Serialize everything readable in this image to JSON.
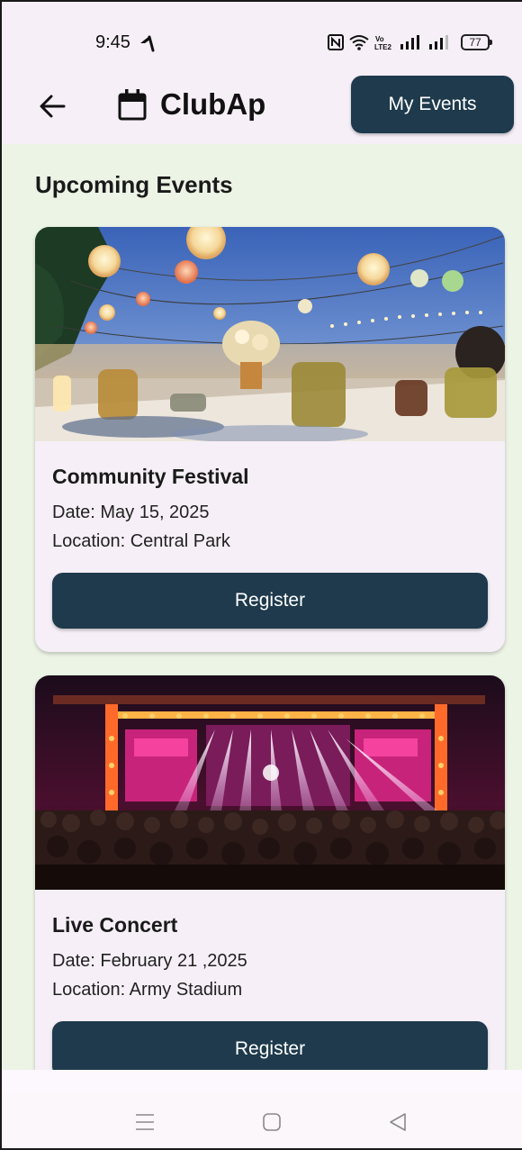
{
  "status_bar": {
    "time": "9:45",
    "battery": "77",
    "icons": [
      "carrier-icon",
      "nfc-icon",
      "wifi-icon",
      "volte-icon",
      "signal-icon",
      "signal-icon",
      "battery-icon"
    ]
  },
  "app_bar": {
    "title": "ClubAp",
    "my_events_label": "My Events"
  },
  "main": {
    "section_title": "Upcoming Events",
    "events": [
      {
        "title": "Community Festival",
        "date": "Date: May 15, 2025",
        "location": "Location: Central Park",
        "register_label": "Register"
      },
      {
        "title": "Live Concert",
        "date": "Date: February 21 ,2025",
        "location": "Location: Army Stadium",
        "register_label": "Register"
      }
    ]
  },
  "colors": {
    "primary": "#1e3a4c",
    "background": "#ecf4e6",
    "surface": "#f6eff7"
  }
}
